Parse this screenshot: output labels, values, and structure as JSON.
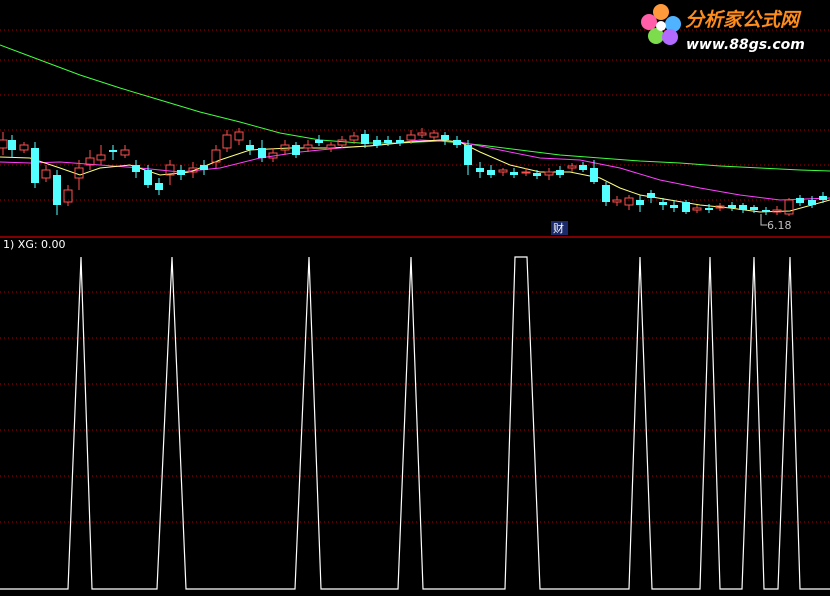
{
  "logo": {
    "site_name": "分析家公式网",
    "url": "www.88gs.com"
  },
  "main_chart": {
    "low_price_label": "6.18",
    "fin_marker": "财",
    "colors": {
      "up_candle": "#ff5050",
      "down_candle": "#54ffff",
      "ma_short": "#ffff80",
      "ma_mid": "#ff40ff",
      "ma_long": "#40ff40",
      "grid": "#b00000",
      "separator": "#ff0000"
    }
  },
  "indicator": {
    "title": "1) XG: 0.00",
    "line_color": "#ffffff"
  }
}
